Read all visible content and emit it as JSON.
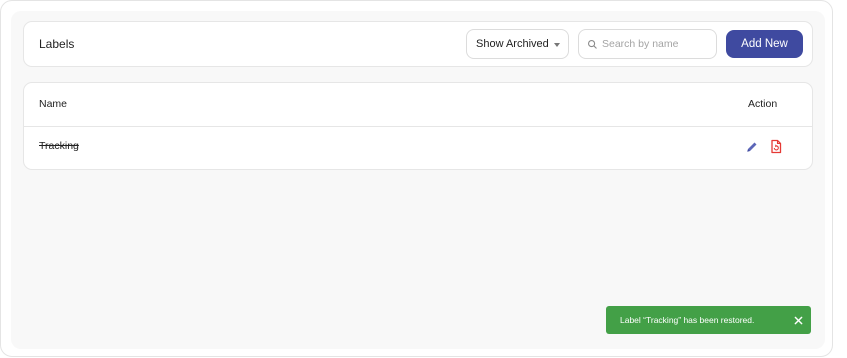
{
  "header": {
    "title": "Labels",
    "archived_filter_label": "Show Archived",
    "search_placeholder": "Search by name",
    "add_button_label": "Add New"
  },
  "table": {
    "columns": [
      "Name",
      "Action"
    ],
    "rows": [
      {
        "name": "Tracking",
        "archived": true
      }
    ]
  },
  "toast": {
    "message": "Label “Tracking” has been restored.",
    "type": "success"
  },
  "colors": {
    "primary": "#3f4aa0",
    "edit_icon": "#5c66b8",
    "restore_icon": "#e53935",
    "toast_success": "#43a047"
  },
  "icons": {
    "search": "search-icon",
    "dropdown": "chevron-down-icon",
    "edit": "pencil-icon",
    "restore": "restore-document-icon",
    "close": "close-icon"
  }
}
